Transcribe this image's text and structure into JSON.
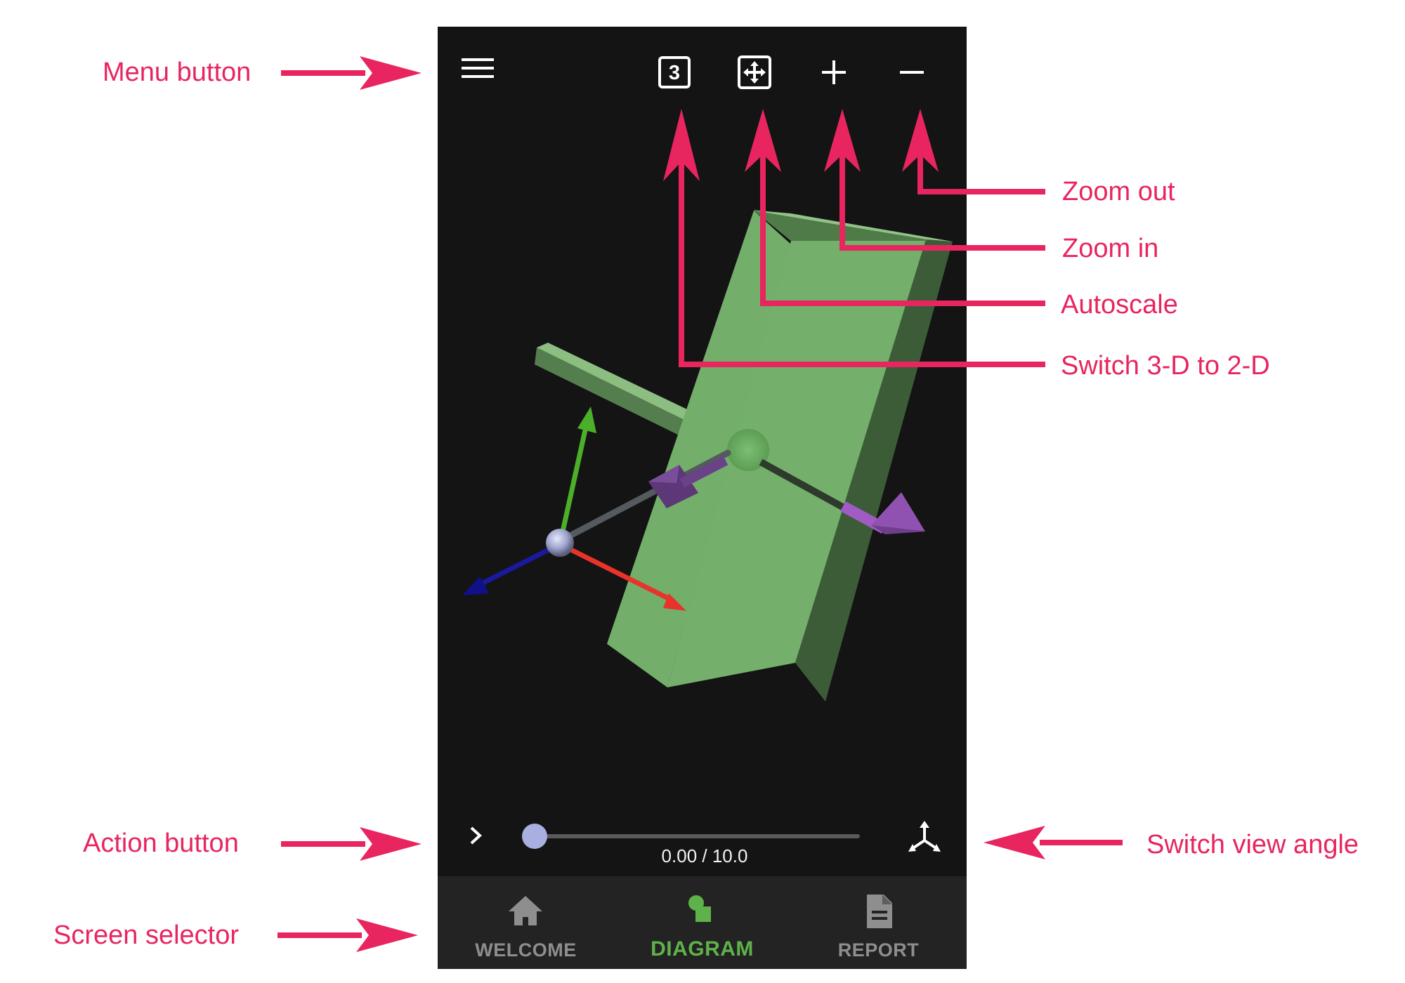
{
  "annotations": {
    "menu": "Menu button",
    "zoom_out": "Zoom out",
    "zoom_in": "Zoom in",
    "autoscale": "Autoscale",
    "switch_3d_2d": "Switch 3-D to 2-D",
    "action": "Action button",
    "view_angle": "Switch view angle",
    "screen_selector": "Screen selector"
  },
  "toolbar": {
    "menu_icon": "hamburger-menu-icon",
    "dimension_icon": "3d-mode-icon",
    "dimension_glyph": "3",
    "autoscale_icon": "autoscale-icon",
    "zoom_in_icon": "plus-icon",
    "zoom_out_icon": "minus-icon"
  },
  "playback": {
    "time_label": "0.00 / 10.0",
    "progress": 0,
    "action_icon": "chevron-right-icon",
    "view_angle_icon": "axes-tripod-icon"
  },
  "nav": {
    "items": [
      {
        "label": "WELCOME",
        "icon": "home-icon",
        "active": false
      },
      {
        "label": "DIAGRAM",
        "icon": "shapes-icon",
        "active": true
      },
      {
        "label": "REPORT",
        "icon": "document-icon",
        "active": false
      }
    ]
  },
  "colors": {
    "annotation": "#e8255f",
    "app_background": "#141414",
    "nav_background": "#232323",
    "active_tab": "#5fb14a",
    "inactive_tab": "#8e8e8e",
    "beam": "#74b06b",
    "axis_x": "#e8332a",
    "axis_y": "#4caf2a",
    "axis_z": "#10108a",
    "force_vector": "#8a4fa8"
  }
}
